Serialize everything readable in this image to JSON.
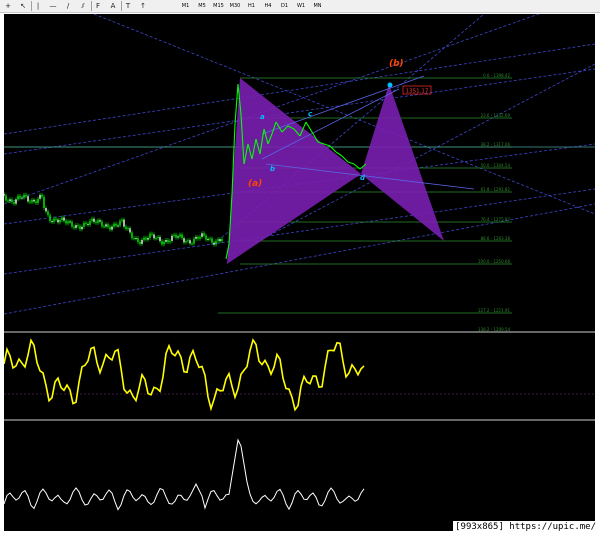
{
  "toolbar": {
    "timeframes": [
      "M1",
      "M5",
      "M15",
      "M30",
      "H1",
      "H4",
      "D1",
      "W1",
      "MN"
    ],
    "icons": [
      "crosshair-icon",
      "cursor-icon",
      "vertical-line-icon",
      "horizontal-line-icon",
      "trendline-icon",
      "channel-icon",
      "fibonacci-icon",
      "text-icon",
      "label-icon",
      "arrow-icon"
    ]
  },
  "chart": {
    "fib_levels": [
      {
        "label": "0.0 - 1398.42"
      },
      {
        "label": "23.6 - 1332.69"
      },
      {
        "label": "38.2 - 1317.06"
      },
      {
        "label": "50.0 - 1304.54"
      },
      {
        "label": "61.8 - 1291.82"
      },
      {
        "label": "76.4 - 1275.97"
      },
      {
        "label": "88.6 - 1263.38"
      },
      {
        "label": "100.0 - 1250.66"
      },
      {
        "label": "127.2 - 1221.91"
      },
      {
        "label": "138.2 - 1209.54"
      }
    ],
    "price_badge": "1351.17",
    "wave_labels": {
      "a_big": "(a)",
      "b_big": "(b)",
      "a_small": "a",
      "b_small": "b",
      "c_small": "c",
      "d_small": "d"
    },
    "colors": {
      "candle_up": "#00ff00",
      "candle_down": "#ffffff",
      "pattern": "#7a1fb0",
      "fib": "#2e8b2e",
      "channel": "#3c46c8",
      "osc1": "#ffff00",
      "osc2": "#ffffff",
      "label_orange": "#ff4500",
      "label_cyan": "#00bfff"
    }
  },
  "watermark": "[993x865] https://upic.me/"
}
